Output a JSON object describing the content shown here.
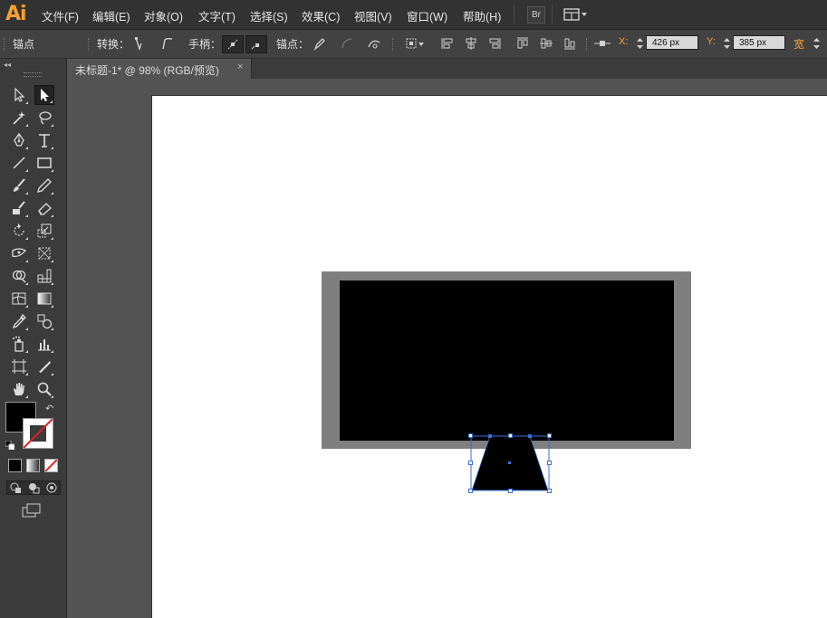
{
  "app": {
    "logo": "Ai"
  },
  "menubar": {
    "items": [
      "文件(F)",
      "编辑(E)",
      "对象(O)",
      "文字(T)",
      "选择(S)",
      "效果(C)",
      "视图(V)",
      "窗口(W)",
      "帮助(H)"
    ],
    "bridge_label": "Br",
    "workspace_icon": "workspace-switcher-icon"
  },
  "control_bar": {
    "tool_label": "锚点",
    "convert_label": "转换：",
    "handles_label": "手柄：",
    "anchors_label": "锚点：",
    "x_label": "X:",
    "x_value": "426 px",
    "y_label": "Y:",
    "y_value": "385 px",
    "width_label": "宽"
  },
  "document": {
    "tab_title": "未标题-1* @ 98% (RGB/预览)",
    "close_glyph": "×"
  },
  "tools_panel": {
    "collapse_glyph": "◂◂",
    "fill_color": "#000000",
    "stroke": "none",
    "tools": [
      "selection-tool-icon",
      "direct-selection-tool-icon",
      "magic-wand-tool-icon",
      "lasso-tool-icon",
      "pen-tool-icon",
      "type-tool-icon",
      "line-segment-tool-icon",
      "rectangle-tool-icon",
      "paintbrush-tool-icon",
      "pencil-tool-icon",
      "blob-brush-tool-icon",
      "eraser-tool-icon",
      "rotate-tool-icon",
      "scale-tool-icon",
      "width-tool-icon",
      "free-transform-tool-icon",
      "shape-builder-tool-icon",
      "perspective-grid-tool-icon",
      "mesh-tool-icon",
      "gradient-tool-icon",
      "eyedropper-tool-icon",
      "blend-tool-icon",
      "symbol-sprayer-tool-icon",
      "column-graph-tool-icon",
      "artboard-tool-icon",
      "slice-tool-icon",
      "hand-tool-icon",
      "zoom-tool-icon"
    ]
  },
  "colors": {
    "accent_orange": "#f2a03a",
    "selection_blue": "#3b6fd8",
    "frame_gray": "#7f7f7f",
    "screen_black": "#000000"
  }
}
